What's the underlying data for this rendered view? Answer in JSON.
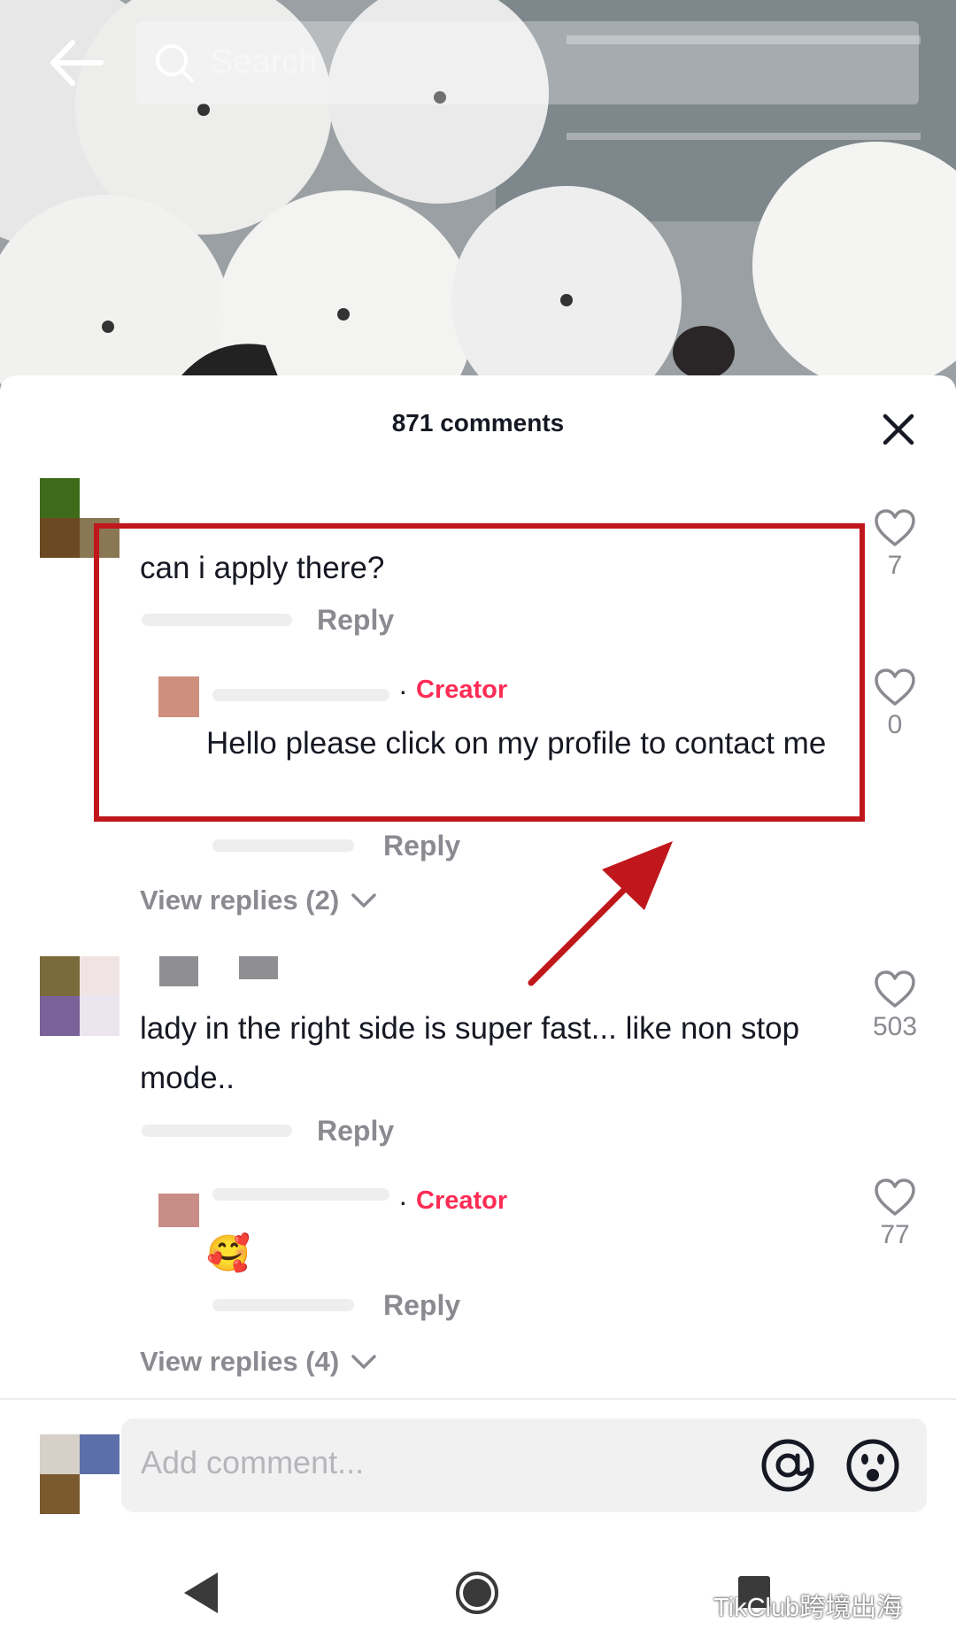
{
  "search": {
    "placeholder": "Search"
  },
  "comments_header": {
    "title": "871 comments"
  },
  "comments": [
    {
      "text": "can i apply there?",
      "reply_label": "Reply",
      "likes": "7",
      "creator_reply": {
        "badge": "Creator",
        "text": "Hello please click on my profile to contact me",
        "reply_label": "Reply",
        "likes": "0"
      },
      "view_replies": "View replies (2)"
    },
    {
      "text": "lady in the right side is super fast... like non stop mode..",
      "reply_label": "Reply",
      "likes": "503",
      "creator_reply": {
        "badge": "Creator",
        "text": "🥰",
        "reply_label": "Reply",
        "likes": "77"
      },
      "view_replies": "View replies (4)"
    }
  ],
  "composer": {
    "placeholder": "Add comment..."
  },
  "watermark": "TikClub跨境出海",
  "colors": {
    "creator": "#fe2c55",
    "highlight": "#c0171d",
    "muted": "#8a8b91"
  },
  "icons": [
    "back-arrow-icon",
    "search-icon",
    "close-icon",
    "heart-icon",
    "chevron-down-icon",
    "at-icon",
    "emoji-icon",
    "nav-back-icon",
    "nav-home-icon",
    "nav-recent-icon"
  ]
}
